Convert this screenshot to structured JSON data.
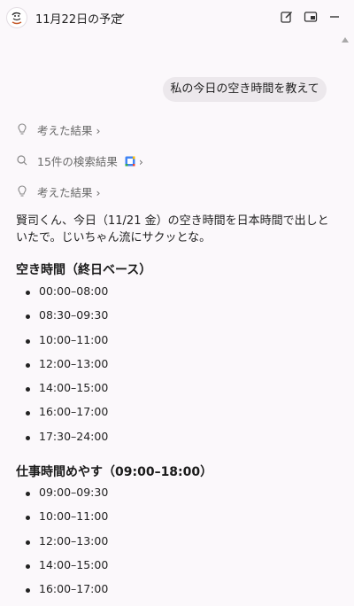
{
  "header": {
    "title": "11月22日の予定",
    "icons": [
      "avatar",
      "chevron-down-icon",
      "edit-icon",
      "picture-in-picture-icon",
      "minimize-icon"
    ]
  },
  "conversation": {
    "user_message": "私の今日の空き時間を教えて",
    "steps": [
      {
        "icon": "lightbulb-icon",
        "label": "考えた結果"
      },
      {
        "icon": "search-icon",
        "label": "15件の検索結果"
      },
      {
        "icon": "lightbulb-icon",
        "label": "考えた結果"
      }
    ],
    "intro": "賢司くん、今日（11/21 金）の空き時間を日本時間で出しといたで。じいちゃん流にサクッとな。",
    "sections": [
      {
        "heading": "空き時間（終日ベース）",
        "items": [
          "00:00–08:00",
          "08:30–09:30",
          "10:00–11:00",
          "12:00–13:00",
          "14:00–15:00",
          "16:00–17:00",
          "17:30–24:00"
        ]
      },
      {
        "heading": "仕事時間めやす（09:00–18:00）",
        "items": [
          "09:00–09:30",
          "10:00–11:00",
          "12:00–13:00",
          "14:00–15:00",
          "16:00–17:00"
        ]
      }
    ]
  },
  "colors": {
    "background": "#fbf8fb",
    "bubble": "#ece8ec",
    "muted_text": "#6a6a6a"
  }
}
